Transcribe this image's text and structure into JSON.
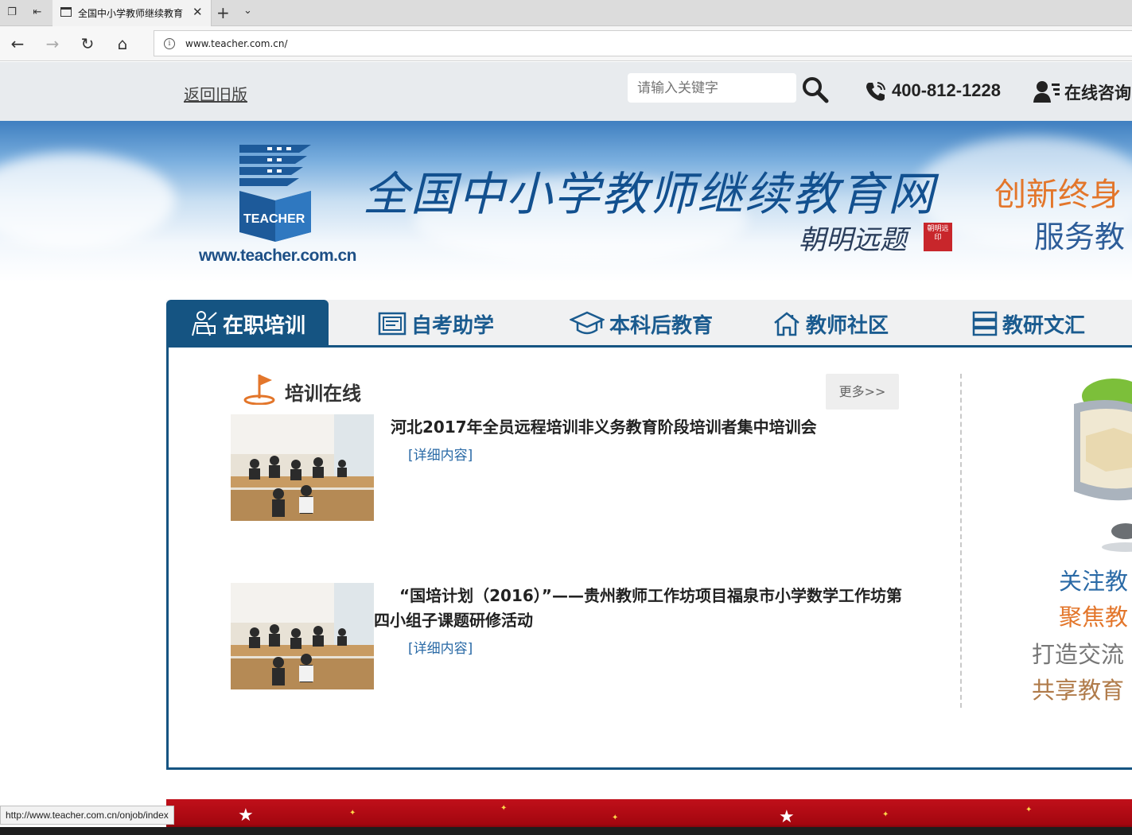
{
  "browser": {
    "tab_title": "全国中小学教师继续教育",
    "url": "www.teacher.com.cn/",
    "status_url": "http://www.teacher.com.cn/onjob/index"
  },
  "header": {
    "old_version_link": "返回旧版",
    "search_placeholder": "请输入关键字",
    "phone": "400-812-1228",
    "consult": "在线咨询"
  },
  "banner": {
    "logo_url": "www.teacher.com.cn",
    "title": "全国中小学教师继续教育网",
    "signature": "朝明远题",
    "seal_text": "朝明远印",
    "slogan_line1": "创新终身",
    "slogan_line2": "服务教"
  },
  "nav": {
    "tabs": [
      {
        "label": "在职培训",
        "icon": "teacher-training-icon",
        "active": true
      },
      {
        "label": "自考助学",
        "icon": "certificate-icon",
        "active": false
      },
      {
        "label": "本科后教育",
        "icon": "graduation-cap-icon",
        "active": false
      },
      {
        "label": "教师社区",
        "icon": "home-icon",
        "active": false
      },
      {
        "label": "教研文汇",
        "icon": "server-stack-icon",
        "active": false
      }
    ]
  },
  "section": {
    "title": "培训在线",
    "more": "更多>>",
    "news": [
      {
        "title": "河北2017年全员远程培训非义务教育阶段培训者集中培训会",
        "detail": "[详细内容]"
      },
      {
        "title_line1": "“国培计划（2016）”——贵州教师工作坊项目福泉市小学数学工作坊第",
        "title_line2": "四小组子课题研修活动",
        "detail": "[详细内容]"
      }
    ]
  },
  "side": {
    "line1": "关注教",
    "line2": "聚焦教",
    "line3": "打造交流",
    "line4": "共享教育"
  },
  "colors": {
    "brand_blue": "#155482",
    "accent_orange": "#e3762b",
    "link_blue": "#2a6aa6"
  }
}
